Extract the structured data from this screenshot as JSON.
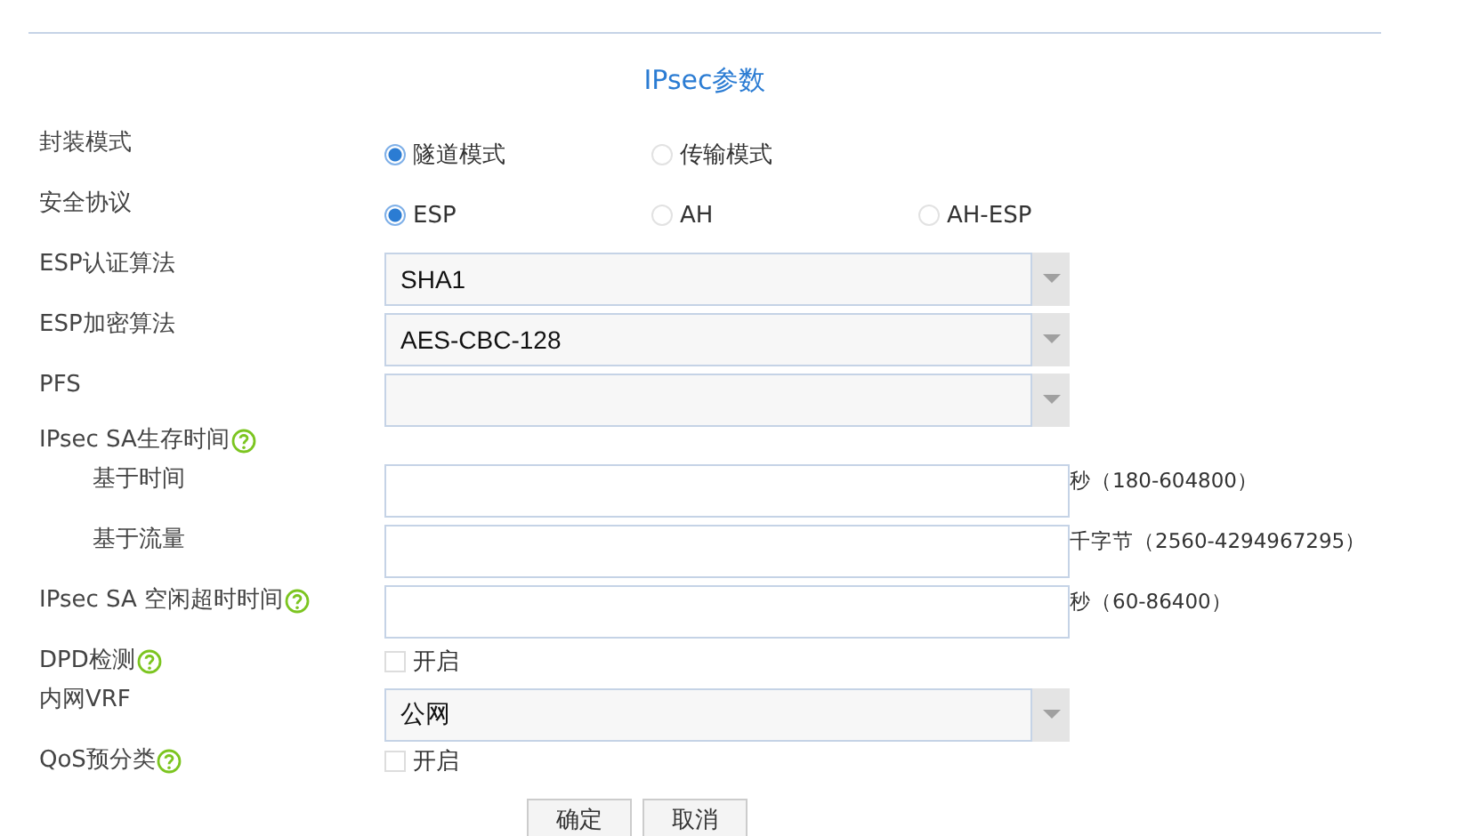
{
  "title": "IPsec参数",
  "rows": [
    {
      "kind": "radio",
      "label": "封装模式",
      "options": [
        {
          "label": "隧道模式",
          "selected": true
        },
        {
          "label": "传输模式",
          "selected": false
        }
      ]
    },
    {
      "kind": "radio",
      "label": "安全协议",
      "options": [
        {
          "label": "ESP",
          "selected": true
        },
        {
          "label": "AH",
          "selected": false
        },
        {
          "label": "AH-ESP",
          "selected": false
        }
      ]
    },
    {
      "kind": "select",
      "label": "ESP认证算法",
      "value": "SHA1"
    },
    {
      "kind": "select",
      "label": "ESP加密算法",
      "value": "AES-CBC-128"
    },
    {
      "kind": "select",
      "label": "PFS"
    },
    {
      "kind": "heading",
      "label": "IPsec SA生存时间",
      "help": true,
      "children": [
        {
          "kind": "input",
          "label": "基于时间",
          "suffix": "秒（180-604800）"
        },
        {
          "kind": "input",
          "label": "基于流量",
          "suffix": "千字节（2560-4294967295）"
        }
      ]
    },
    {
      "kind": "input",
      "label": "IPsec SA 空闲超时时间",
      "help": true,
      "suffix": "秒（60-86400）"
    },
    {
      "kind": "checkbox",
      "label": "DPD检测",
      "help": true,
      "option": "开启",
      "checked": false
    },
    {
      "kind": "select",
      "label": "内网VRF",
      "value": "公网"
    },
    {
      "kind": "checkbox",
      "label": "QoS预分类",
      "help": true,
      "option": "开启",
      "checked": false
    }
  ],
  "buttons": [
    "确定",
    "取消"
  ]
}
